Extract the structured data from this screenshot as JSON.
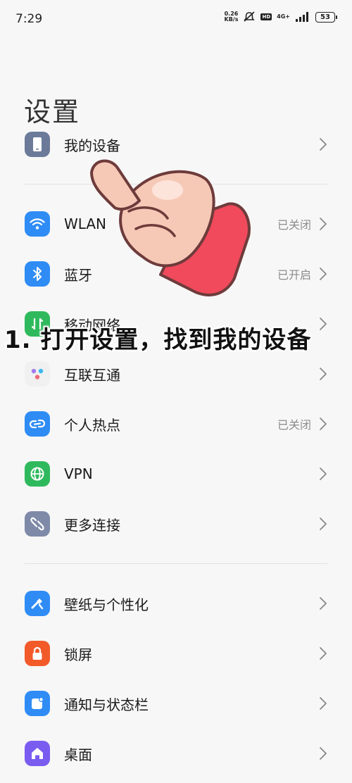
{
  "status_bar": {
    "time": "7:29",
    "net_speed_value": "0.26",
    "net_speed_unit": "KB/s",
    "hd_label": "HD",
    "network_type": "4G+",
    "battery": "53"
  },
  "page": {
    "title": "设置"
  },
  "groups": [
    {
      "items": [
        {
          "label": "我的设备",
          "value": "",
          "icon": "phone-device-icon",
          "color": "#6b7a99"
        }
      ]
    },
    {
      "items": [
        {
          "label": "WLAN",
          "value": "已关闭",
          "icon": "wifi-icon",
          "color": "#2f8cf5"
        },
        {
          "label": "蓝牙",
          "value": "已开启",
          "icon": "bluetooth-icon",
          "color": "#2f8cf5"
        },
        {
          "label": "移动网络",
          "value": "",
          "icon": "mobile-network-icon",
          "color": "#2fb95d"
        },
        {
          "label": "互联互通",
          "value": "",
          "icon": "interconnect-icon",
          "color": "#f0f0f0"
        },
        {
          "label": "个人热点",
          "value": "已关闭",
          "icon": "hotspot-icon",
          "color": "#2f8cf5"
        },
        {
          "label": "VPN",
          "value": "",
          "icon": "globe-icon",
          "color": "#2fb95d"
        },
        {
          "label": "更多连接",
          "value": "",
          "icon": "link-icon",
          "color": "#7f8aa8"
        }
      ]
    },
    {
      "items": [
        {
          "label": "壁纸与个性化",
          "value": "",
          "icon": "brush-icon",
          "color": "#2f8cf5"
        },
        {
          "label": "锁屏",
          "value": "",
          "icon": "lock-icon",
          "color": "#f25a2a"
        },
        {
          "label": "通知与状态栏",
          "value": "",
          "icon": "notification-icon",
          "color": "#2f8cf5"
        },
        {
          "label": "桌面",
          "value": "",
          "icon": "home-icon",
          "color": "#7a5cf0"
        }
      ]
    }
  ],
  "overlay": {
    "caption": "1. 打开设置，找到我的设备"
  }
}
